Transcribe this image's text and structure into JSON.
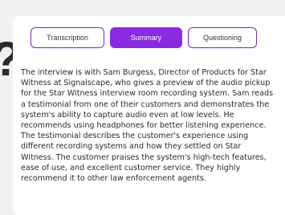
{
  "decor": {
    "char": "?"
  },
  "tabs": [
    {
      "label": "Transcription",
      "active": false
    },
    {
      "label": "Summary",
      "active": true
    },
    {
      "label": "Questioning",
      "active": false
    }
  ],
  "summary": {
    "text": "The interview is with Sam Burgess, Director of Products for Star Witness at Signalscape, who gives a preview of the audio pickup for the Star Witness interview room recording system. Sam reads a testimonial from one of their customers and demonstrates the system's ability to capture audio even at low levels. He recommends using headphones for better listening experience. The testimonial describes the customer's experience using different recording systems and how they settled on Star Witness. The customer praises the system's high-tech features, ease of use, and excellent customer service. They highly recommend it to other law enforcement agents."
  },
  "colors": {
    "accent": "#8a2be2",
    "background": "#f1f1f4",
    "card": "#ffffff"
  }
}
